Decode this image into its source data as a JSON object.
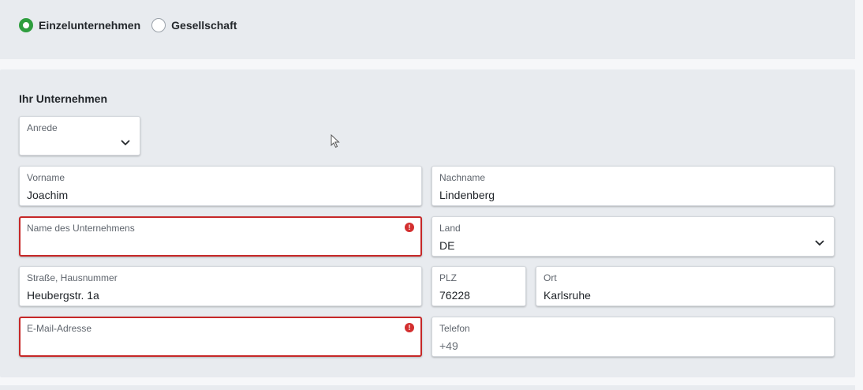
{
  "type_selector": {
    "options": [
      {
        "label": "Einzelunternehmen",
        "selected": true
      },
      {
        "label": "Gesellschaft",
        "selected": false
      }
    ]
  },
  "company_section": {
    "title": "Ihr Unternehmen",
    "salutation": {
      "label": "Anrede",
      "value": ""
    },
    "first_name": {
      "label": "Vorname",
      "value": "Joachim"
    },
    "last_name": {
      "label": "Nachname",
      "value": "Lindenberg"
    },
    "company_name": {
      "label": "Name des Unternehmens",
      "value": "",
      "error": true
    },
    "country": {
      "label": "Land",
      "value": "DE"
    },
    "street": {
      "label": "Straße, Hausnummer",
      "value": "Heubergstr. 1a"
    },
    "zip": {
      "label": "PLZ",
      "value": "76228"
    },
    "city": {
      "label": "Ort",
      "value": "Karlsruhe"
    },
    "email": {
      "label": "E-Mail-Adresse",
      "value": "",
      "error": true
    },
    "phone": {
      "label": "Telefon",
      "placeholder": "+49"
    }
  },
  "icons": {
    "dropdown": "chevron-down-icon",
    "error": "error-alert-icon",
    "cursor": "mouse-cursor-icon"
  },
  "colors": {
    "accent_green": "#2e9e3e",
    "error_red": "#c62828",
    "panel_bg": "#e8ebef"
  }
}
